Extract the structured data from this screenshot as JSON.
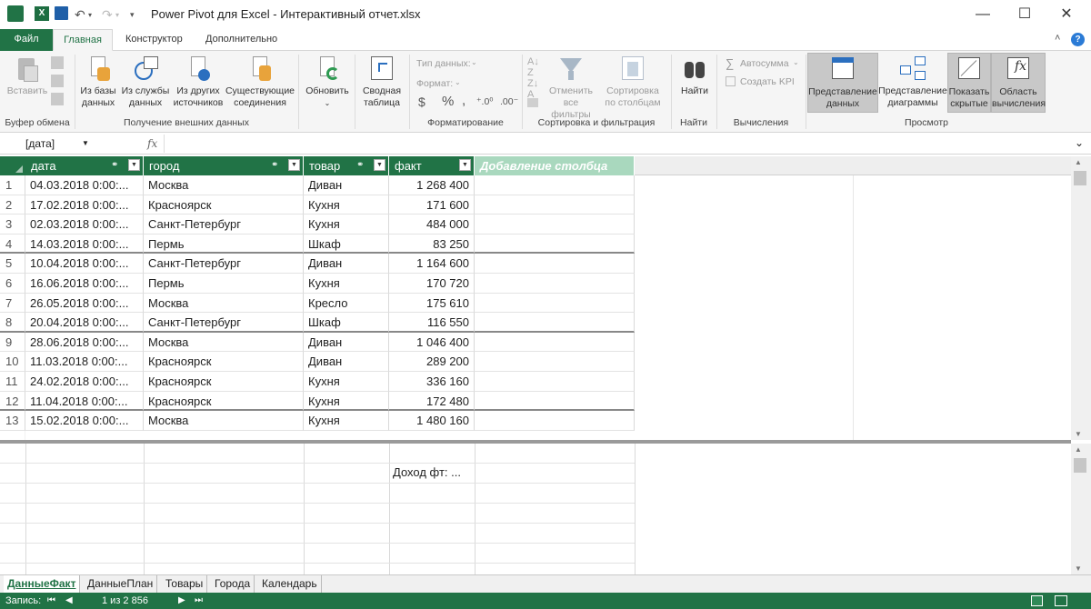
{
  "window": {
    "title": "Power Pivot для Excel - Интерактивный отчет.xlsx",
    "minimize": "—",
    "maximize": "☐",
    "close": "✕"
  },
  "tabs": [
    {
      "label": "Файл"
    },
    {
      "label": "Главная"
    },
    {
      "label": "Конструктор"
    },
    {
      "label": "Дополнительно"
    }
  ],
  "ribbon": {
    "clipboard": {
      "paste": "Вставить",
      "group": "Буфер обмена"
    },
    "external": {
      "from_db": [
        "Из базы",
        "данных"
      ],
      "from_service": [
        "Из службы",
        "данных"
      ],
      "from_other": [
        "Из других",
        "источников"
      ],
      "existing": [
        "Существующие",
        "соединения"
      ],
      "group": "Получение внешних данных"
    },
    "refresh": "Обновить",
    "pivot": [
      "Сводная",
      "таблица"
    ],
    "format": {
      "type_label": "Тип данных:",
      "format_label": "Формат:",
      "currency": "$",
      "percent": "%",
      "comma": ",",
      "dec_inc": "⁺.0⁰",
      "dec_dec": ".00⁻",
      "group": "Форматирование"
    },
    "sortfilter": {
      "clear": [
        "Отменить",
        "все фильтры"
      ],
      "sort_by_col": [
        "Сортировка",
        "по столбцам"
      ],
      "group": "Сортировка и фильтрация"
    },
    "find": {
      "button": "Найти",
      "group": "Найти"
    },
    "calc": {
      "autosum": "Автосумма",
      "kpi": "Создать KPI",
      "group": "Вычисления"
    },
    "view": {
      "data_view": [
        "Представление",
        "данных"
      ],
      "diagram_view": [
        "Представление",
        "диаграммы"
      ],
      "show_hidden": [
        "Показать",
        "скрытые"
      ],
      "calc_area": [
        "Область",
        "вычисления"
      ],
      "group": "Просмотр"
    }
  },
  "formula_bar": {
    "name_box": "[дата]",
    "fx": "fx",
    "expand": "⌄"
  },
  "columns": [
    {
      "label": "дата"
    },
    {
      "label": "город"
    },
    {
      "label": "товар"
    },
    {
      "label": "факт"
    },
    {
      "label": "Добавление столбца"
    }
  ],
  "rows": [
    {
      "n": "1",
      "date": "04.03.2018 0:00:...",
      "city": "Москва",
      "item": "Диван",
      "fact": "1 268 400"
    },
    {
      "n": "2",
      "date": "17.02.2018 0:00:...",
      "city": "Красноярск",
      "item": "Кухня",
      "fact": "171 600"
    },
    {
      "n": "3",
      "date": "02.03.2018 0:00:...",
      "city": "Санкт-Петербург",
      "item": "Кухня",
      "fact": "484 000"
    },
    {
      "n": "4",
      "date": "14.03.2018 0:00:...",
      "city": "Пермь",
      "item": "Шкаф",
      "fact": "83 250"
    },
    {
      "n": "5",
      "date": "10.04.2018 0:00:...",
      "city": "Санкт-Петербург",
      "item": "Диван",
      "fact": "1 164 600"
    },
    {
      "n": "6",
      "date": "16.06.2018 0:00:...",
      "city": "Пермь",
      "item": "Кухня",
      "fact": "170 720"
    },
    {
      "n": "7",
      "date": "26.05.2018 0:00:...",
      "city": "Москва",
      "item": "Кресло",
      "fact": "175 610"
    },
    {
      "n": "8",
      "date": "20.04.2018 0:00:...",
      "city": "Санкт-Петербург",
      "item": "Шкаф",
      "fact": "116 550"
    },
    {
      "n": "9",
      "date": "28.06.2018 0:00:...",
      "city": "Москва",
      "item": "Диван",
      "fact": "1 046 400"
    },
    {
      "n": "10",
      "date": "11.03.2018 0:00:...",
      "city": "Красноярск",
      "item": "Диван",
      "fact": "289 200"
    },
    {
      "n": "11",
      "date": "24.02.2018 0:00:...",
      "city": "Красноярск",
      "item": "Кухня",
      "fact": "336 160"
    },
    {
      "n": "12",
      "date": "11.04.2018 0:00:...",
      "city": "Красноярск",
      "item": "Кухня",
      "fact": "172 480"
    },
    {
      "n": "13",
      "date": "15.02.2018 0:00:...",
      "city": "Москва",
      "item": "Кухня",
      "fact": "1 480 160"
    }
  ],
  "calc_area": {
    "measure": "Доход фт: ..."
  },
  "sheets": [
    {
      "label": "ДанныеФакт"
    },
    {
      "label": "ДанныеПлан"
    },
    {
      "label": "Товары"
    },
    {
      "label": "Города"
    },
    {
      "label": "Календарь"
    }
  ],
  "status": {
    "record_label": "Запись:",
    "record_pos": "1 из 2 856"
  },
  "colors": {
    "accent": "#217346",
    "add_column": "#a9d8be"
  }
}
